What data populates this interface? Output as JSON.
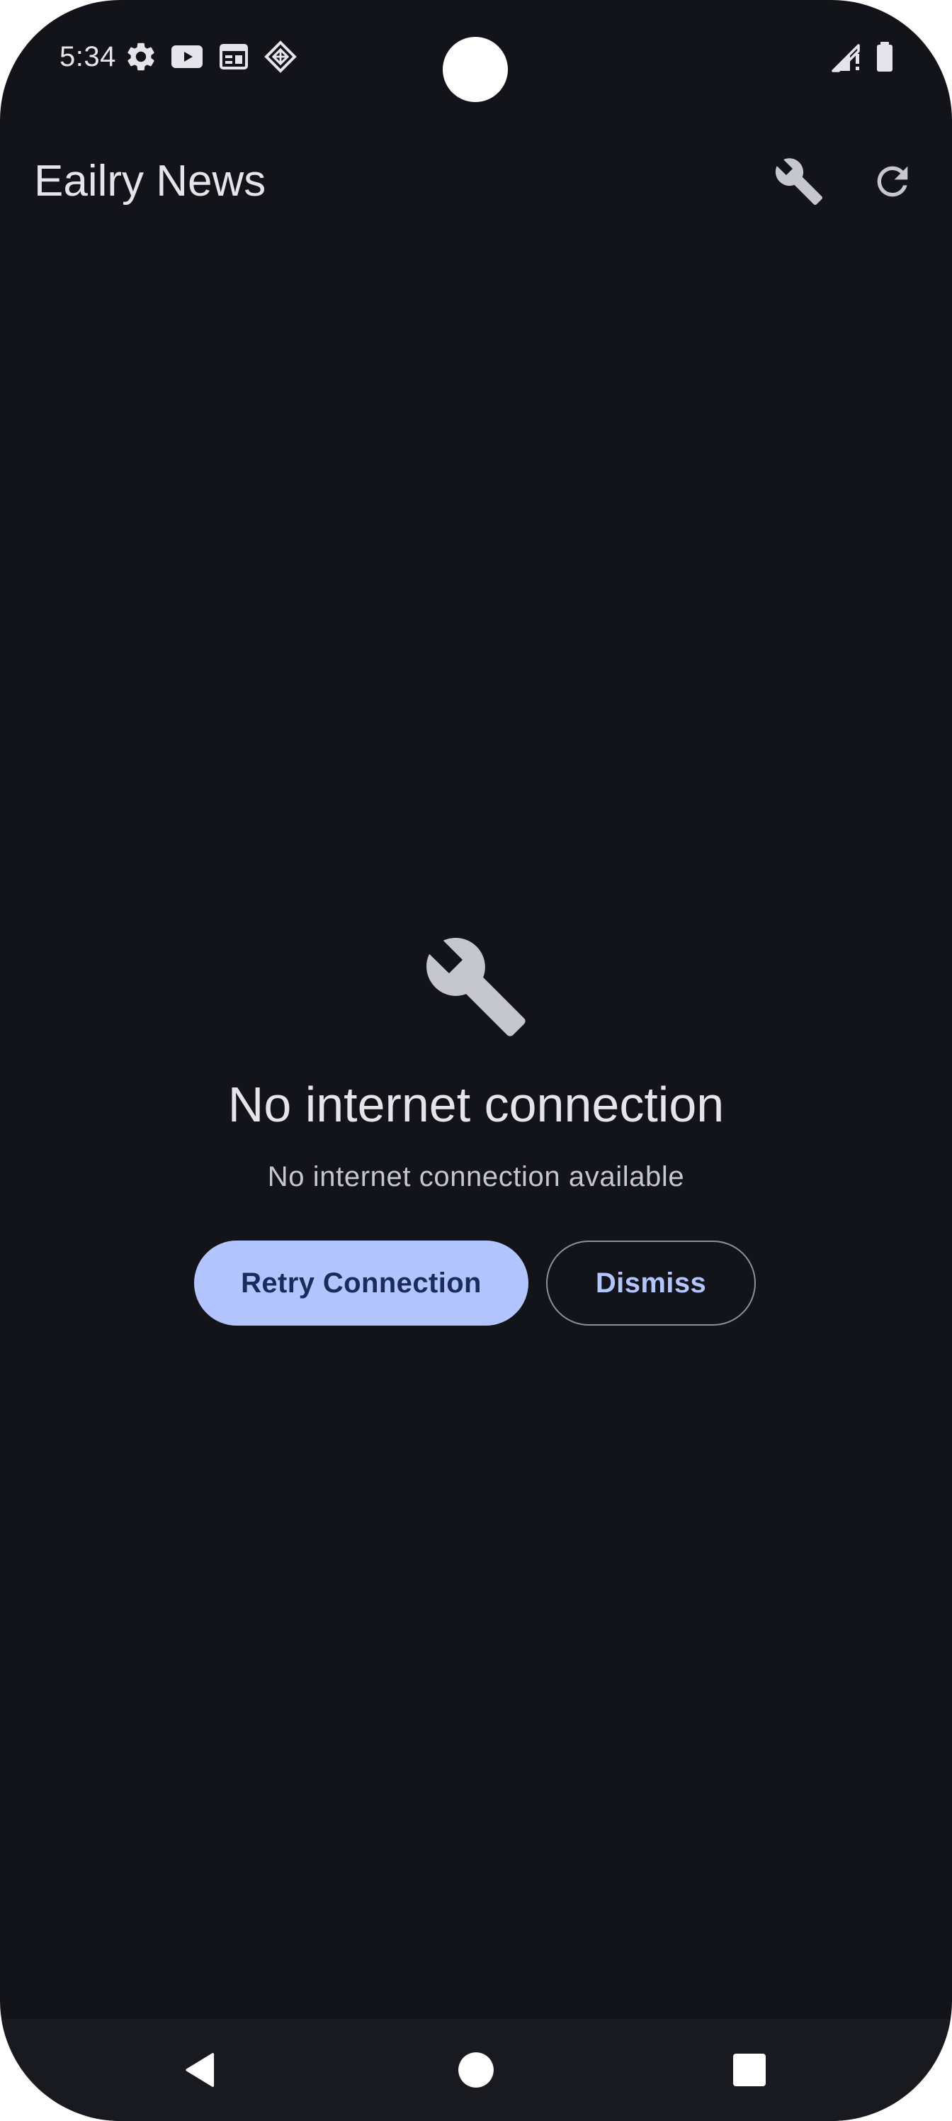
{
  "status_bar": {
    "time": "5:34",
    "icons": [
      "settings-gear-icon",
      "youtube-icon",
      "calendar-icon",
      "diamond-app-icon",
      "cell-signal-icon",
      "battery-icon"
    ]
  },
  "app_bar": {
    "title": "Eailry News",
    "actions": [
      "wrench-icon",
      "refresh-icon"
    ]
  },
  "error_state": {
    "icon": "wrench-icon",
    "title": "No internet connection",
    "message": "No internet connection available",
    "primary_button": "Retry Connection",
    "secondary_button": "Dismiss"
  },
  "nav_bar": {
    "buttons": [
      "back-icon",
      "home-icon",
      "recents-icon"
    ]
  },
  "colors": {
    "background": "#131419",
    "primary": "#b2c5ff",
    "on_primary": "#1b2c5c",
    "on_surface": "#e4e4ea",
    "icon": "#c6c6ce"
  }
}
